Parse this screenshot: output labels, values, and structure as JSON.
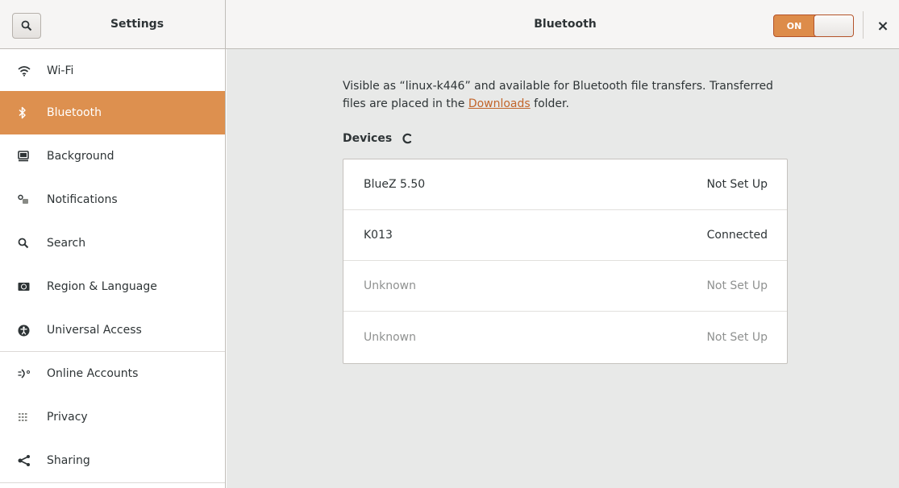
{
  "header": {
    "left_title": "Settings",
    "main_title": "Bluetooth",
    "switch_label": "ON",
    "close_glyph": "×"
  },
  "sidebar": {
    "items": [
      {
        "label": "Wi-Fi",
        "icon": "wifi-icon"
      },
      {
        "label": "Bluetooth",
        "icon": "bluetooth-icon",
        "selected": true
      },
      {
        "label": "Background",
        "icon": "background-icon"
      },
      {
        "label": "Notifications",
        "icon": "notifications-icon"
      },
      {
        "label": "Search",
        "icon": "search-icon"
      },
      {
        "label": "Region & Language",
        "icon": "region-icon"
      },
      {
        "label": "Universal Access",
        "icon": "universal-access-icon"
      },
      {
        "label": "Online Accounts",
        "icon": "online-accounts-icon"
      },
      {
        "label": "Privacy",
        "icon": "privacy-icon"
      },
      {
        "label": "Sharing",
        "icon": "sharing-icon"
      }
    ]
  },
  "main": {
    "description_part1": "Visible as “linux-k446” and available for Bluetooth file transfers. Transferred files are placed in the ",
    "description_link": "Downloads",
    "description_part2": " folder.",
    "devices_title": "Devices",
    "devices": [
      {
        "name": "BlueZ 5.50",
        "status": "Not Set Up"
      },
      {
        "name": "K013",
        "status": "Connected"
      },
      {
        "name": "Unknown",
        "status": "Not Set Up"
      },
      {
        "name": "Unknown",
        "status": "Not Set Up"
      }
    ]
  },
  "colors": {
    "accent": "#dd904f",
    "link": "#c2652b",
    "content_bg": "#e8e9e8"
  }
}
